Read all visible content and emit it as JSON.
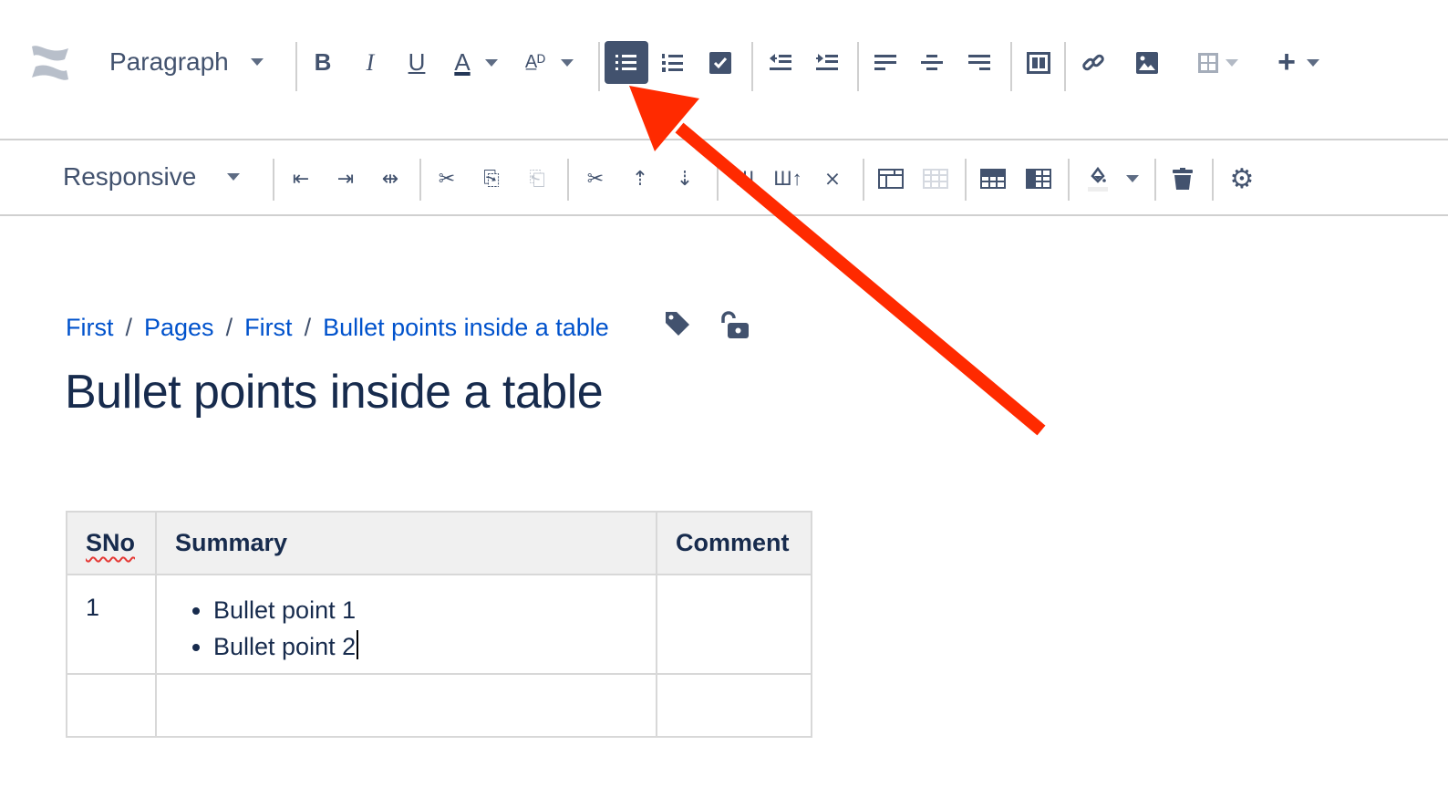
{
  "toolbar": {
    "style_select": "Paragraph",
    "icons": [
      "confluence-logo",
      "bold-icon",
      "italic-icon",
      "underline-icon",
      "text-color-icon",
      "text-format-icon",
      "bullet-list-icon",
      "numbered-list-icon",
      "task-list-icon",
      "outdent-icon",
      "indent-icon",
      "align-left-icon",
      "align-center-icon",
      "align-right-icon",
      "page-layout-icon",
      "link-icon",
      "image-icon",
      "table-icon",
      "insert-more-icon"
    ],
    "active": "bullet-list-icon"
  },
  "table_toolbar": {
    "width_select": "Responsive",
    "icons": [
      "row-insert-before-icon",
      "row-insert-after-icon",
      "row-delete-icon",
      "cut-row-icon",
      "copy-row-icon",
      "paste-row-icon",
      "cut-column-icon",
      "copy-column-icon",
      "paste-column-icon",
      "column-insert-before-icon",
      "column-insert-after-icon",
      "column-delete-icon",
      "merge-cells-icon",
      "split-cell-icon",
      "header-row-icon",
      "header-column-icon",
      "cell-color-icon",
      "delete-table-icon",
      "table-settings-icon"
    ]
  },
  "breadcrumb": [
    "First",
    "Pages",
    "First",
    "Bullet points inside a table"
  ],
  "breadcrumb_separator": "/",
  "page": {
    "title": "Bullet points inside a table"
  },
  "table": {
    "headers": [
      "SNo",
      "Summary",
      "Comment"
    ],
    "rows": [
      {
        "sno": "1",
        "bullets": [
          "Bullet point 1",
          "Bullet point 2"
        ],
        "comment": ""
      },
      {
        "sno": "",
        "bullets": [],
        "comment": ""
      }
    ]
  },
  "colors": {
    "icon": "#42526e",
    "link": "#0052cc",
    "arrow": "#ff2a00",
    "active_bg": "#42526e"
  }
}
